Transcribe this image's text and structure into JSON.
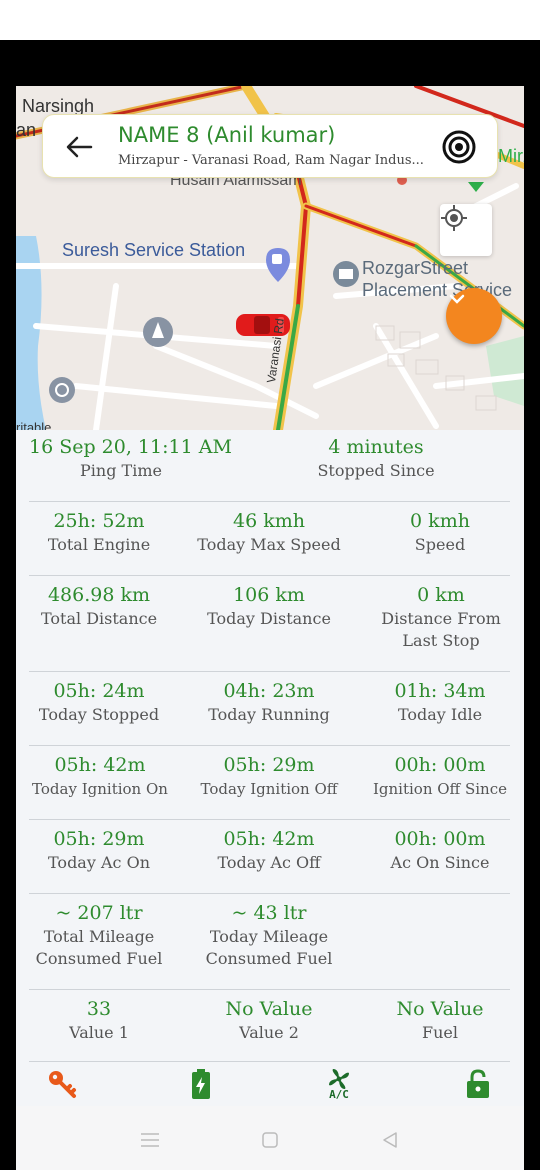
{
  "header": {
    "vehicle_name": "NAME 8 (Anil kumar)",
    "address": "Mirzapur - Varanasi Road, Ram Nagar Indus..."
  },
  "map": {
    "labels": {
      "narsingh": "Narsingh",
      "an": "an",
      "husain": "Husain Alamissam",
      "suresh": "Suresh Service Station",
      "rozgar1": "RozgarStreet",
      "rozgar2": "Placement Service",
      "mirzapur": "Mirz",
      "road": "Varanasi Rd",
      "table": "ritable"
    }
  },
  "stats": {
    "ping_time": {
      "value": "16 Sep 20, 11:11 AM",
      "label": "Ping Time"
    },
    "stopped_since": {
      "value": "4 minutes",
      "label": "Stopped Since"
    },
    "total_engine": {
      "value": "25h: 52m",
      "label": "Total Engine"
    },
    "today_max_speed": {
      "value": "46 kmh",
      "label": "Today Max Speed"
    },
    "speed": {
      "value": "0 kmh",
      "label": "Speed"
    },
    "total_distance": {
      "value": "486.98 km",
      "label": "Total Distance"
    },
    "today_distance": {
      "value": "106 km",
      "label": "Today Distance"
    },
    "distance_from_last_stop": {
      "value": "0 km",
      "label": "Distance From Last Stop"
    },
    "today_stopped": {
      "value": "05h: 24m",
      "label": "Today Stopped"
    },
    "today_running": {
      "value": "04h: 23m",
      "label": "Today Running"
    },
    "today_idle": {
      "value": "01h: 34m",
      "label": "Today Idle"
    },
    "today_ignition_on": {
      "value": "05h: 42m",
      "label": "Today Ignition On"
    },
    "today_ignition_off": {
      "value": "05h: 29m",
      "label": "Today Ignition Off"
    },
    "ignition_off_since": {
      "value": "00h: 00m",
      "label": "Ignition Off Since"
    },
    "today_ac_on": {
      "value": "05h: 29m",
      "label": "Today Ac On"
    },
    "today_ac_off": {
      "value": "05h: 42m",
      "label": "Today Ac Off"
    },
    "ac_on_since": {
      "value": "00h: 00m",
      "label": "Ac On Since"
    },
    "total_mileage_fuel": {
      "value": "~ 207 ltr",
      "label": "Total Mileage Consumed Fuel"
    },
    "today_mileage_fuel": {
      "value": "~ 43 ltr",
      "label": "Today Mileage Consumed Fuel"
    },
    "value1": {
      "value": "33",
      "label": "Value 1"
    },
    "value2": {
      "value": "No Value",
      "label": "Value 2"
    },
    "fuel": {
      "value": "No Value",
      "label": "Fuel"
    }
  },
  "action_bar": {
    "icons": [
      "key-icon",
      "battery-charging-icon",
      "ac-fan-icon",
      "lock-icon"
    ],
    "ac_label": "A/C"
  },
  "colors": {
    "accent_green": "#2e8b2e",
    "orange": "#f3861f",
    "car_red": "#e11b1b",
    "key_orange": "#e8591a"
  }
}
